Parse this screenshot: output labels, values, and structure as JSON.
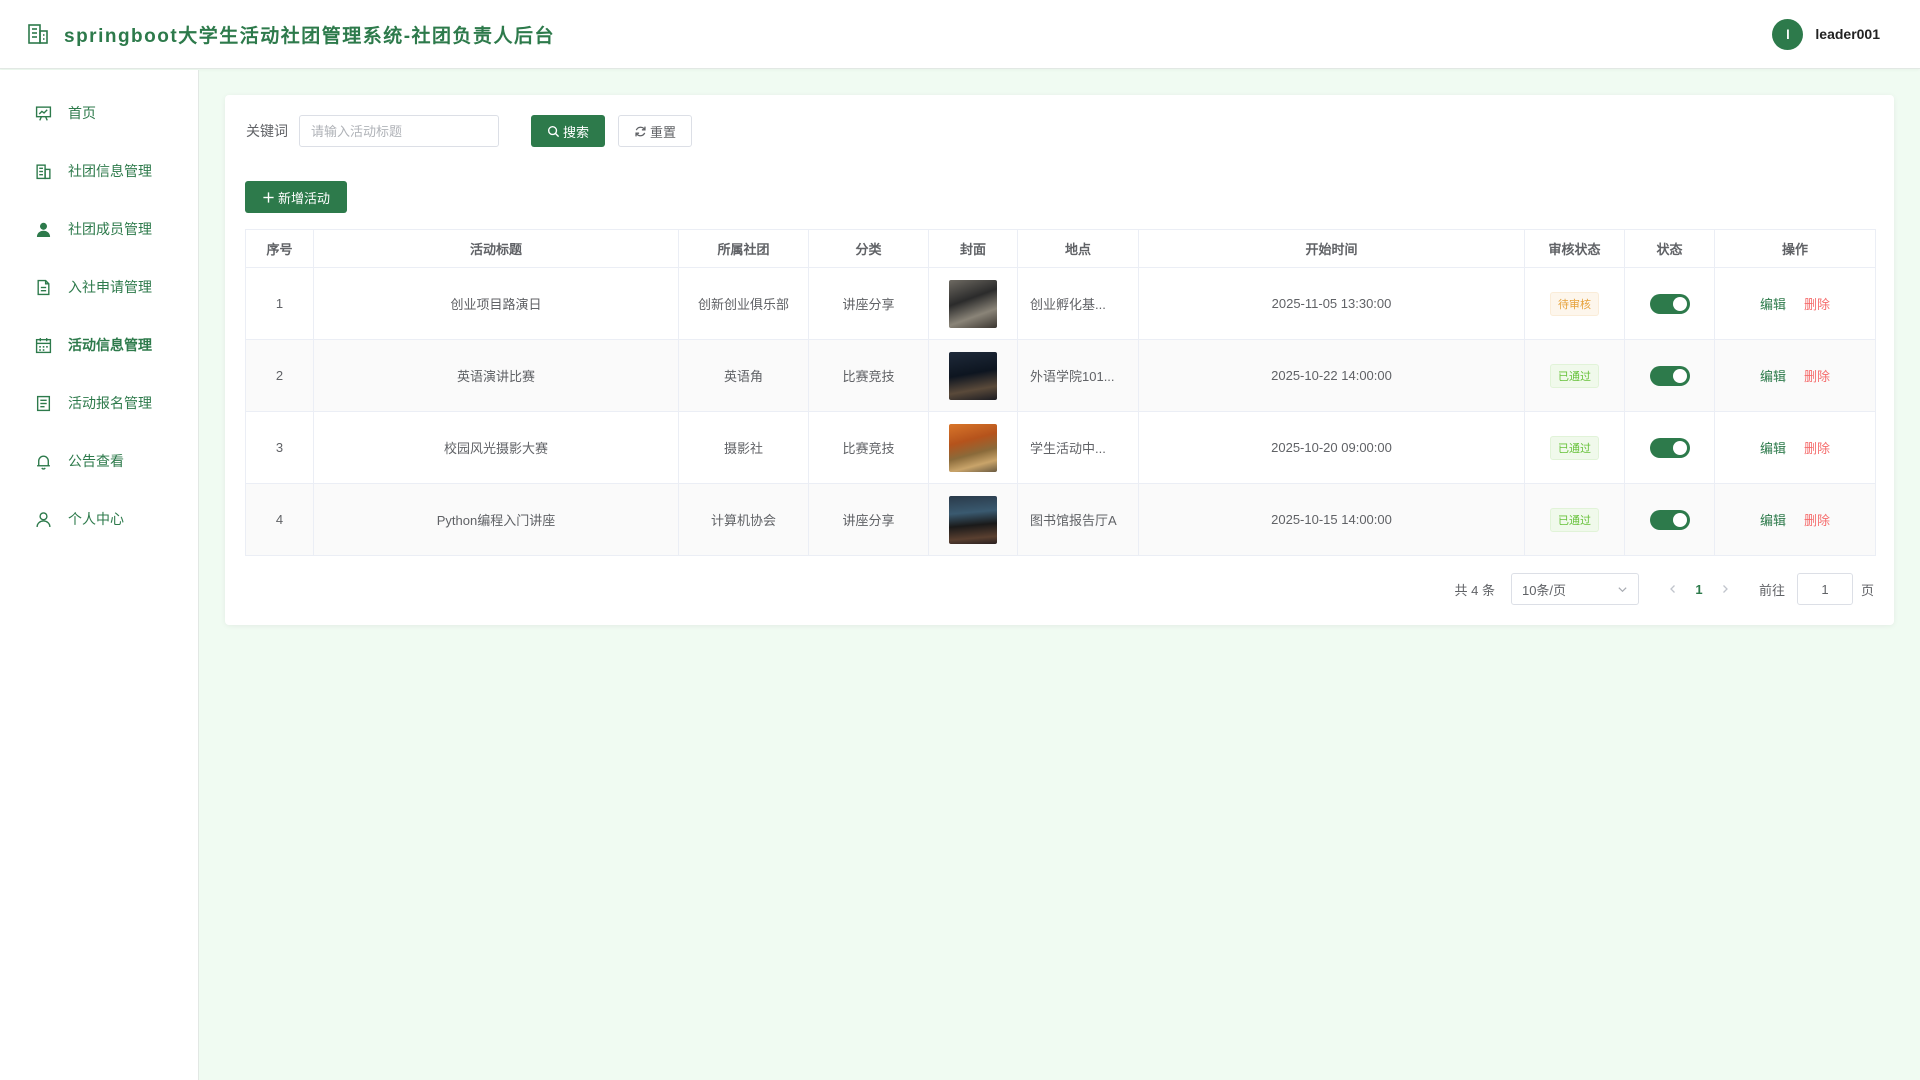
{
  "header": {
    "title": "springboot大学生活动社团管理系统-社团负责人后台",
    "avatar_letter": "l",
    "username": "leader001"
  },
  "sidebar": {
    "items": [
      {
        "label": "首页",
        "icon": "dashboard-icon"
      },
      {
        "label": "社团信息管理",
        "icon": "building-icon"
      },
      {
        "label": "社团成员管理",
        "icon": "user-filled-icon"
      },
      {
        "label": "入社申请管理",
        "icon": "document-icon"
      },
      {
        "label": "活动信息管理",
        "icon": "calendar-icon",
        "active": true
      },
      {
        "label": "活动报名管理",
        "icon": "list-document-icon"
      },
      {
        "label": "公告查看",
        "icon": "bell-icon"
      },
      {
        "label": "个人中心",
        "icon": "user-icon"
      }
    ]
  },
  "search": {
    "label": "关键词",
    "placeholder": "请输入活动标题",
    "value": "",
    "search_label": "搜索",
    "reset_label": "重置"
  },
  "toolbar": {
    "add_label": "新增活动"
  },
  "table": {
    "columns": [
      "序号",
      "活动标题",
      "所属社团",
      "分类",
      "封面",
      "地点",
      "开始时间",
      "审核状态",
      "状态",
      "操作"
    ],
    "rows": [
      {
        "index": "1",
        "title": "创业项目路演日",
        "club": "创新创业俱乐部",
        "category": "讲座分享",
        "cover": "cover-pitch-event",
        "location": "创业孵化基...",
        "start": "2025-11-05 13:30:00",
        "review": "待审核",
        "review_type": "pending",
        "enabled": true,
        "edit": "编辑",
        "delete": "删除"
      },
      {
        "index": "2",
        "title": "英语演讲比赛",
        "club": "英语角",
        "category": "比赛竞技",
        "cover": "cover-speech",
        "location": "外语学院101...",
        "start": "2025-10-22 14:00:00",
        "review": "已通过",
        "review_type": "passed",
        "enabled": true,
        "edit": "编辑",
        "delete": "删除"
      },
      {
        "index": "3",
        "title": "校园风光摄影大赛",
        "club": "摄影社",
        "category": "比赛竞技",
        "cover": "cover-autumn-campus",
        "location": "学生活动中...",
        "start": "2025-10-20 09:00:00",
        "review": "已通过",
        "review_type": "passed",
        "enabled": true,
        "edit": "编辑",
        "delete": "删除"
      },
      {
        "index": "4",
        "title": "Python编程入门讲座",
        "club": "计算机协会",
        "category": "讲座分享",
        "cover": "cover-lecture-hall",
        "location": "图书馆报告厅A",
        "start": "2025-10-15 14:00:00",
        "review": "已通过",
        "review_type": "passed",
        "enabled": true,
        "edit": "编辑",
        "delete": "删除"
      }
    ]
  },
  "pagination": {
    "total": "共 4 条",
    "page_size": "10条/页",
    "current_page": "1",
    "goto_label": "前往",
    "goto_value": "1",
    "goto_suffix": "页"
  },
  "colors": {
    "primary": "#2d7a4b",
    "danger": "#f56c6c",
    "warning": "#e6a23c",
    "success": "#67c23a",
    "background": "#f0fbf2"
  }
}
